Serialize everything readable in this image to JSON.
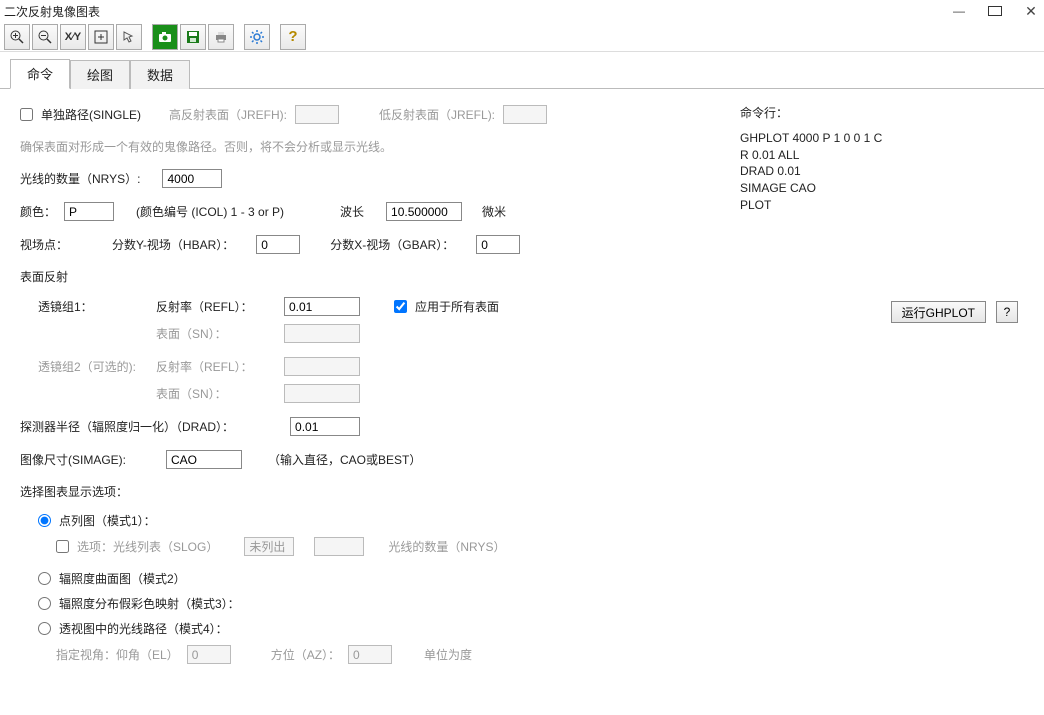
{
  "window": {
    "title": "二次反射鬼像图表"
  },
  "toolbar_icons": {
    "zoom_in": "zoom-in",
    "zoom_out": "zoom-out",
    "xy": "XY",
    "fit": "fit",
    "pointer": "pointer",
    "camera": "camera",
    "save": "save",
    "print": "print",
    "gear": "gear",
    "help": "?"
  },
  "tabs": {
    "cmd": "命令",
    "plot": "绘图",
    "data": "数据",
    "active": "cmd"
  },
  "form": {
    "single": {
      "label": "单独路径(SINGLE)",
      "checked": false
    },
    "jrefh": {
      "label": "高反射表面（JREFH):",
      "value": ""
    },
    "jrefl": {
      "label": "低反射表面（JREFL):",
      "value": ""
    },
    "note_line": "确保表面对形成一个有效的鬼像路径。否则，将不会分析或显示光线。",
    "nrys": {
      "label": "光线的数量（NRYS）:",
      "value": "4000"
    },
    "color": {
      "label": "颜色：",
      "value": "P",
      "hint": "(颜色编号 (ICOL) 1 - 3 or P)"
    },
    "wavelength": {
      "label": "波长",
      "value": "10.500000",
      "unit": "微米"
    },
    "fieldpoint": "视场点：",
    "hbar": {
      "label": "分数Y-视场（HBAR）：",
      "value": "0"
    },
    "gbar": {
      "label": "分数X-视场（GBAR）：",
      "value": "0"
    },
    "surf_section": "表面反射",
    "grp1": {
      "label": "透镜组1：",
      "refl_label": "反射率（REFL）：",
      "refl_value": "0.01",
      "apply_all": {
        "label": "应用于所有表面",
        "checked": true
      },
      "sn_label": "表面（SN）：",
      "sn_value": ""
    },
    "grp2": {
      "label": "透镜组2（可选的):",
      "refl_label": "反射率（REFL）：",
      "refl_value": "",
      "sn_label": "表面（SN）：",
      "sn_value": ""
    },
    "drad": {
      "label": "探测器半径（辐照度归一化）（DRAD）：",
      "value": "0.01"
    },
    "simage": {
      "label": "图像尺寸(SIMAGE):",
      "value": "CAO",
      "hint": "（输入直径，CAO或BEST）"
    },
    "disp_section": "选择图表显示选项：",
    "mode1": {
      "label": "点列图（模式1）：",
      "checked": true
    },
    "slog": {
      "opt_label": "选项：光线列表（SLOG）",
      "opt_checked": false,
      "unlisted": "未列出",
      "nrys_hint": "光线的数量（NRYS）"
    },
    "mode2": {
      "label": "辐照度曲面图（模式2）",
      "checked": false
    },
    "mode3": {
      "label": "辐照度分布假彩色映射（模式3）：",
      "checked": false
    },
    "mode4": {
      "label": "透视图中的光线路径（模式4）：",
      "checked": false
    },
    "view": {
      "label": "指定视角：仰角（EL）",
      "el_value": "0",
      "az_label": "方位（AZ）：",
      "az_value": "0",
      "unit": "单位为度"
    }
  },
  "cmd_panel": {
    "header": "命令行：",
    "lines": [
      "GHPLOT 4000 P 1 0 0 1 C",
      "R 0.01 ALL",
      "DRAD 0.01",
      "SIMAGE CAO",
      "PLOT"
    ]
  },
  "buttons": {
    "run": "运行GHPLOT",
    "help": "?"
  }
}
